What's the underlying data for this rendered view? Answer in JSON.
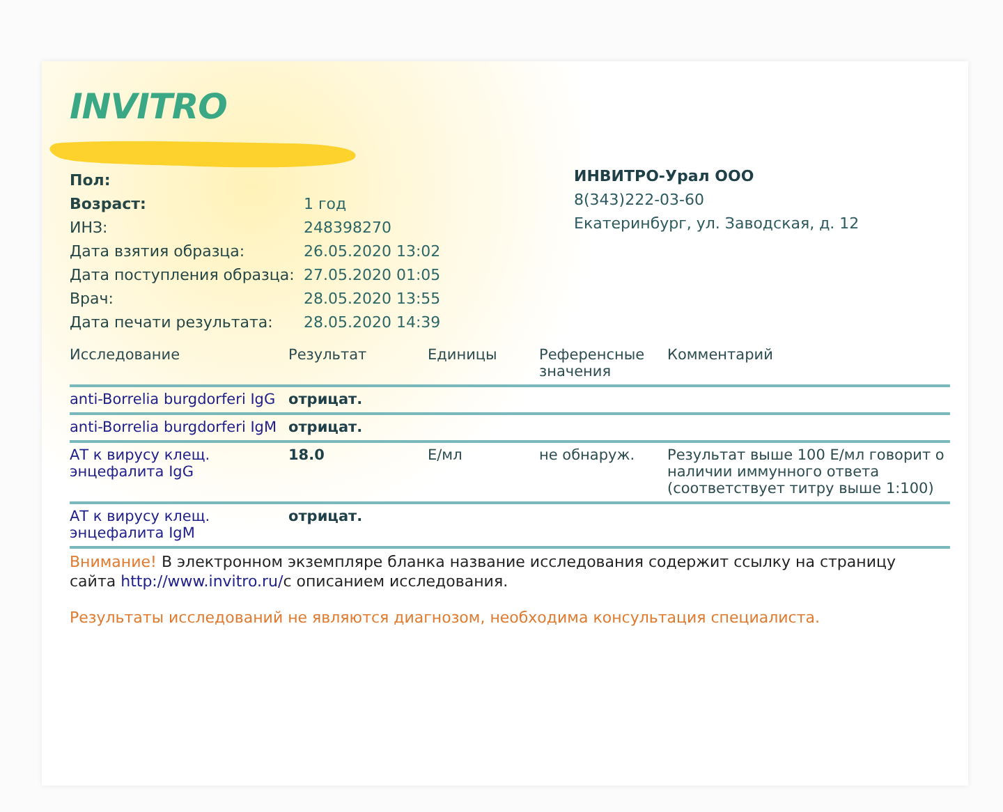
{
  "logo": "INVITRO",
  "patient_fields": [
    {
      "label": "Пол:",
      "emphasized": true
    },
    {
      "label": "Возраст:",
      "value": "1 год",
      "emphasized": true
    },
    {
      "label": "ИНЗ:",
      "value": "248398270",
      "emphasized": false
    },
    {
      "label": "Дата взятия образца:",
      "value": "26.05.2020 13:02",
      "emphasized": false
    },
    {
      "label": "Дата поступления образца:",
      "value": "27.05.2020 01:05",
      "emphasized": false
    },
    {
      "label": "Врач:",
      "value": "28.05.2020 13:55",
      "emphasized": false
    },
    {
      "label": "Дата печати результата:",
      "value": "28.05.2020 14:39",
      "emphasized": false
    }
  ],
  "lab": {
    "name": "ИНВИТРО-Урал ООО",
    "phone": "8(343)222-03-60",
    "address": "Екатеринбург, ул. Заводская, д. 12"
  },
  "table": {
    "columns": [
      "Исследование",
      "Результат",
      "Единицы",
      "Референсные значения",
      "Комментарий"
    ],
    "rows": [
      {
        "test": "anti-Borrelia burgdorferi IgG",
        "result": "отрицат."
      },
      {
        "test": "anti-Borrelia burgdorferi IgM",
        "result": "отрицат."
      },
      {
        "test": "АТ к вирусу клещ. энцефалита IgG",
        "result": "18.0",
        "units": "Е/мл",
        "reference": "не обнаруж.",
        "comment": "Результат выше 100 Е/мл говорит о наличии иммунного ответа (соответствует титру выше 1:100)"
      },
      {
        "test": "АТ к вирусу клещ. энцефалита IgM",
        "result": "отрицат."
      }
    ]
  },
  "notice": {
    "warning": "Внимание!",
    "text": "В электронном экземпляре бланка название исследования содержит ссылку на страницу сайта",
    "link": "http://www.invitro.ru/",
    "text_after": "с описанием исследования."
  },
  "disclaimer": "Результаты исследований не являются диагнозом, необходима консультация специалиста."
}
